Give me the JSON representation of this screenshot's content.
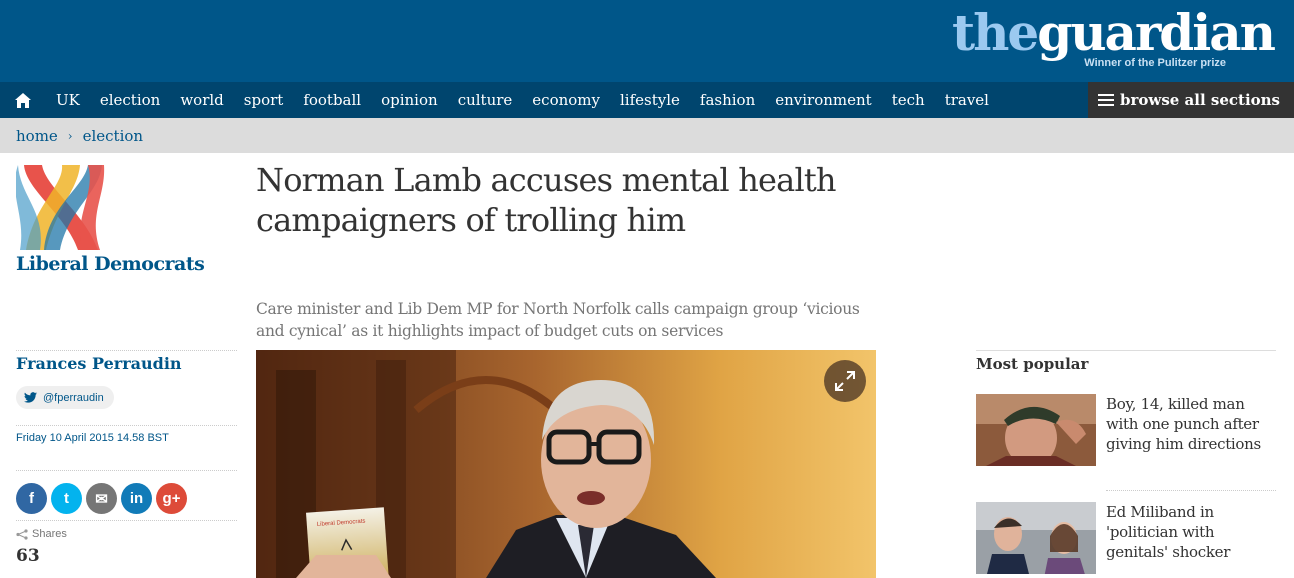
{
  "header": {
    "logo_the": "the",
    "logo_guardian": "guardian",
    "tagline": "Winner of the Pulitzer prize"
  },
  "nav": {
    "items": [
      "UK",
      "election",
      "world",
      "sport",
      "football",
      "opinion",
      "culture",
      "economy",
      "lifestyle",
      "fashion",
      "environment",
      "tech",
      "travel"
    ],
    "browse_label": "browse all sections"
  },
  "breadcrumb": {
    "home": "home",
    "separator": "›",
    "section": "election"
  },
  "sidebar": {
    "party_name": "Liberal Democrats",
    "author": "Frances Perraudin",
    "twitter_handle": "@fperraudin",
    "dateline": "Friday 10 April 2015 14.58 BST",
    "shares_label": "Shares",
    "shares_count": "63",
    "share_buttons": [
      {
        "name": "facebook",
        "glyph": "f",
        "color": "#3067a3"
      },
      {
        "name": "twitter",
        "glyph": "t",
        "color": "#03b3ee"
      },
      {
        "name": "email",
        "glyph": "✉",
        "color": "#767676"
      },
      {
        "name": "linkedin",
        "glyph": "in",
        "color": "#117bb8"
      },
      {
        "name": "googleplus",
        "glyph": "g+",
        "color": "#dd4b39"
      }
    ]
  },
  "article": {
    "headline": "Norman Lamb accuses mental health campaigners of trolling him",
    "standfirst": "Care minister and Lib Dem MP for North Norfolk calls campaign group ‘vicious and cynical’ as it highlights impact of budget cuts on services",
    "image_leaflet_text": "Liberal Democrats"
  },
  "most_popular": {
    "title": "Most popular",
    "items": [
      {
        "text": "Boy, 14, killed man with one punch after giving him directions"
      },
      {
        "text": "Ed Miliband in 'politician with genitals' shocker"
      }
    ]
  },
  "colors": {
    "brand_blue": "#005689",
    "nav_blue": "#00456e",
    "browse_bg": "#333333",
    "breadcrumb_bg": "#dcdcdc"
  }
}
